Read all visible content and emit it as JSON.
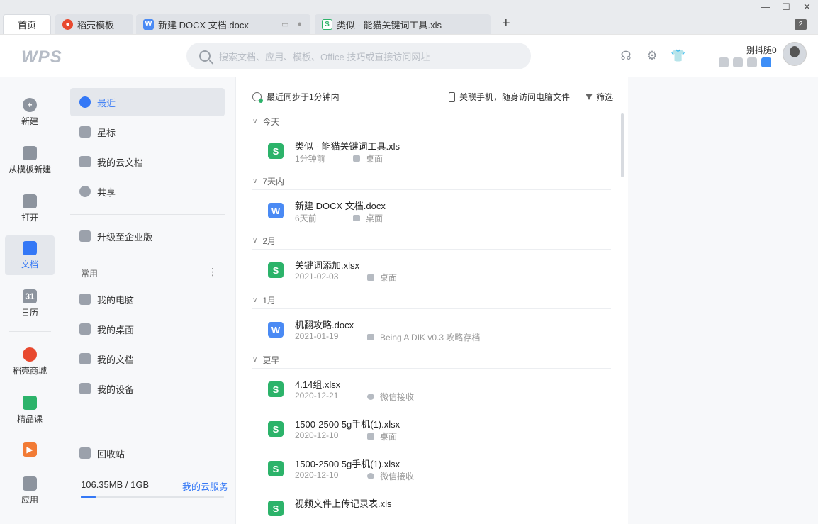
{
  "tabs": {
    "home": "首页",
    "t1": "稻壳模板",
    "t2": "新建 DOCX 文档.docx",
    "t3": "类似 - 能猫关键词工具.xls",
    "new_tab": "+",
    "tab_count": "2"
  },
  "header": {
    "logo": "WPS",
    "search_placeholder": "搜索文档、应用、模板、Office 技巧或直接访问网址",
    "username": "别抖腿0"
  },
  "leftnav": [
    {
      "label": "新建"
    },
    {
      "label": "从模板新建"
    },
    {
      "label": "打开"
    },
    {
      "label": "文档"
    },
    {
      "label": "日历",
      "icon_text": "31"
    },
    {
      "label": "稻壳商城"
    },
    {
      "label": "精品课"
    },
    {
      "label": ""
    },
    {
      "label": "应用"
    }
  ],
  "sidebar": {
    "items": [
      "最近",
      "星标",
      "我的云文档",
      "共享"
    ],
    "upgrade": "升级至企业版",
    "common_label": "常用",
    "common_items": [
      "我的电脑",
      "我的桌面",
      "我的文档",
      "我的设备"
    ],
    "trash": "回收站",
    "storage": "106.35MB / 1GB",
    "cloud_service": "我的云服务",
    "storage_used_fraction": 0.104
  },
  "main": {
    "sync": "最近同步于1分钟内",
    "phone": "关联手机，随身访问电脑文件",
    "filter": "筛选",
    "groups": [
      "今天",
      "7天内",
      "2月",
      "1月",
      "更早"
    ],
    "files": [
      {
        "type": "S",
        "name": "类似 - 能猫关键词工具.xls",
        "date": "1分钟前",
        "loc": "桌面"
      },
      {
        "type": "W",
        "name": "新建 DOCX 文档.docx",
        "date": "6天前",
        "loc": "桌面"
      },
      {
        "type": "S",
        "name": "关键词添加.xlsx",
        "date": "2021-02-03",
        "loc": "桌面"
      },
      {
        "type": "W",
        "name": "机翻攻略.docx",
        "date": "2021-01-19",
        "loc": "Being A DIK v0.3 攻略存档"
      },
      {
        "type": "S",
        "name": "4.14组.xlsx",
        "date": "2020-12-21",
        "loc": "微信接收"
      },
      {
        "type": "S",
        "name": "1500-2500 5g手机(1).xlsx",
        "date": "2020-12-10",
        "loc": "桌面"
      },
      {
        "type": "S",
        "name": "1500-2500 5g手机(1).xlsx",
        "date": "2020-12-10",
        "loc": "微信接收"
      },
      {
        "type": "S",
        "name": "视频文件上传记录表.xls",
        "date": "",
        "loc": ""
      }
    ]
  },
  "colors": {
    "accent": "#3478f6",
    "sheet": "#2cb36a",
    "doc": "#4a8af4"
  }
}
